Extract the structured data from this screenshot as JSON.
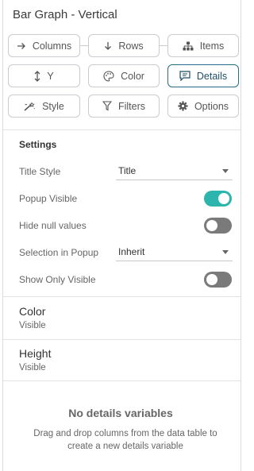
{
  "panel": {
    "title": "Bar Graph - Vertical"
  },
  "tabs": [
    {
      "label": "Columns",
      "icon": "arrow-right-icon"
    },
    {
      "label": "Rows",
      "icon": "arrow-down-icon"
    },
    {
      "label": "Items",
      "icon": "hierarchy-icon"
    },
    {
      "label": "Y",
      "icon": "vertical-arrows-icon"
    },
    {
      "label": "Color",
      "icon": "palette-icon"
    },
    {
      "label": "Details",
      "icon": "comment-icon",
      "active": true
    },
    {
      "label": "Style",
      "icon": "magic-wand-icon"
    },
    {
      "label": "Filters",
      "icon": "filter-icon"
    },
    {
      "label": "Options",
      "icon": "gear-icon"
    }
  ],
  "settings": {
    "heading": "Settings",
    "title_style": {
      "label": "Title Style",
      "value": "Title"
    },
    "popup_visible": {
      "label": "Popup Visible",
      "on": true
    },
    "hide_null": {
      "label": "Hide null values",
      "on": false
    },
    "selection_in_popup": {
      "label": "Selection in Popup",
      "value": "Inherit"
    },
    "show_only_visible": {
      "label": "Show Only Visible",
      "on": false
    }
  },
  "variables": [
    {
      "name": "Color",
      "status": "Visible"
    },
    {
      "name": "Height",
      "status": "Visible"
    }
  ],
  "empty_state": {
    "title": "No details variables",
    "description": "Drag and drop columns from the data table to create a new details variable"
  },
  "colors": {
    "accent": "#2bb5ad",
    "active_border": "#2a6a8a",
    "toggle_off": "#7a7a7a"
  }
}
